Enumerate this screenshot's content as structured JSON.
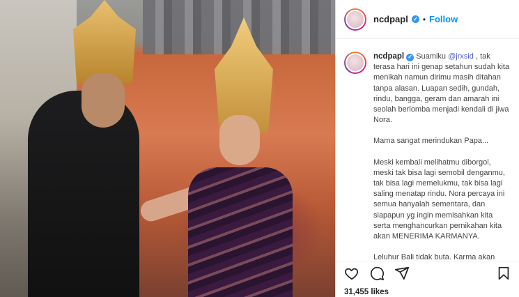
{
  "post": {
    "username": "ncdpapl",
    "dot": "•",
    "follow_label": "Follow",
    "verified_glyph": "✓"
  },
  "caption": {
    "username": "ncdpapl",
    "p1_before": " Suamiku ",
    "mention": "@jrxsid",
    "p1_after": " , tak terasa hari ini genap setahun sudah kita menikah namun dirimu masih ditahan tanpa alasan. Luapan sedih, gundah, rindu, bangga, geram dan amarah ini seolah berlomba menjadi kendali di jiwa Nora.",
    "p2": "Mama sangat merindukan Papa...",
    "p3": "Meski kembali melihatmu diborgol, meski tak bisa lagi semobil denganmu, tak bisa lagi memelukmu, tak bisa lagi saling menatap rindu. Nora percaya ini semua hanyalah sementara, dan siapapun yg ingin memisahkan kita serta menghancurkan pernikahan kita akan MENERIMA KARMANYA.",
    "p4": "Leluhur Bali tidak buta. Karma akan"
  },
  "actions": {
    "icons": [
      "heart-icon",
      "comment-icon",
      "share-icon",
      "bookmark-icon"
    ],
    "likes": "31,455 likes"
  },
  "colors": {
    "accent": "#0095f6",
    "verified": "#3897f0",
    "mention": "#4a5fd0"
  }
}
